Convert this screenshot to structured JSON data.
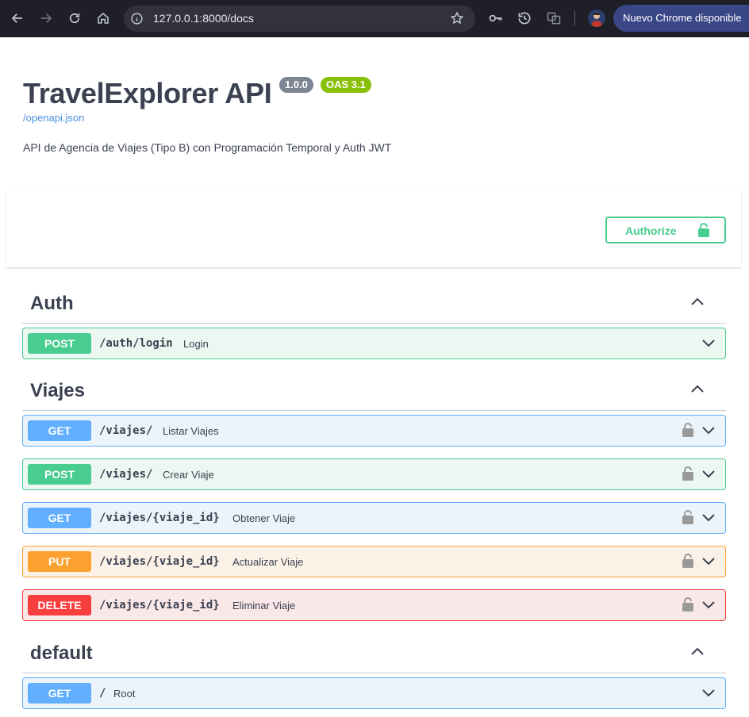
{
  "browser": {
    "url": "127.0.0.1:8000/docs",
    "update_label": "Nuevo Chrome disponible"
  },
  "info": {
    "title": "TravelExplorer API",
    "version": "1.0.0",
    "oas": "OAS 3.1",
    "spec_link": "/openapi.json",
    "description": "API de Agencia de Viajes (Tipo B) con Programación Temporal y Auth JWT"
  },
  "authorize": {
    "label": "Authorize"
  },
  "sections": [
    {
      "name": "Auth",
      "operations": [
        {
          "method": "POST",
          "path": "/auth/login",
          "summary": "Login",
          "locked": false
        }
      ]
    },
    {
      "name": "Viajes",
      "operations": [
        {
          "method": "GET",
          "path": "/viajes/",
          "summary": "Listar Viajes",
          "locked": true
        },
        {
          "method": "POST",
          "path": "/viajes/",
          "summary": "Crear Viaje",
          "locked": true
        },
        {
          "method": "GET",
          "path": "/viajes/{viaje_id}",
          "summary": "Obtener Viaje",
          "locked": true
        },
        {
          "method": "PUT",
          "path": "/viajes/{viaje_id}",
          "summary": "Actualizar Viaje",
          "locked": true
        },
        {
          "method": "DELETE",
          "path": "/viajes/{viaje_id}",
          "summary": "Eliminar Viaje",
          "locked": true
        }
      ]
    },
    {
      "name": "default",
      "operations": [
        {
          "method": "GET",
          "path": "/",
          "summary": "Root",
          "locked": false
        }
      ]
    }
  ],
  "colors": {
    "post": "#49cc90",
    "get": "#61affe",
    "put": "#fca130",
    "delete": "#f93e3e",
    "link": "#4990e2"
  }
}
